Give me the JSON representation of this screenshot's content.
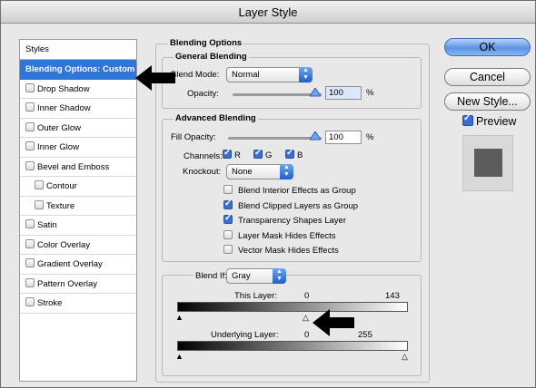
{
  "window": {
    "title": "Layer Style"
  },
  "sidebar": {
    "header": "Styles",
    "items": [
      {
        "label": "Blending Options: Custom",
        "selected": true,
        "checkbox": false,
        "checked": false,
        "indent": false
      },
      {
        "label": "Drop Shadow",
        "selected": false,
        "checkbox": true,
        "checked": false,
        "indent": false
      },
      {
        "label": "Inner Shadow",
        "selected": false,
        "checkbox": true,
        "checked": false,
        "indent": false
      },
      {
        "label": "Outer Glow",
        "selected": false,
        "checkbox": true,
        "checked": false,
        "indent": false
      },
      {
        "label": "Inner Glow",
        "selected": false,
        "checkbox": true,
        "checked": false,
        "indent": false
      },
      {
        "label": "Bevel and Emboss",
        "selected": false,
        "checkbox": true,
        "checked": false,
        "indent": false
      },
      {
        "label": "Contour",
        "selected": false,
        "checkbox": true,
        "checked": false,
        "indent": true
      },
      {
        "label": "Texture",
        "selected": false,
        "checkbox": true,
        "checked": false,
        "indent": true
      },
      {
        "label": "Satin",
        "selected": false,
        "checkbox": true,
        "checked": false,
        "indent": false
      },
      {
        "label": "Color Overlay",
        "selected": false,
        "checkbox": true,
        "checked": false,
        "indent": false
      },
      {
        "label": "Gradient Overlay",
        "selected": false,
        "checkbox": true,
        "checked": false,
        "indent": false
      },
      {
        "label": "Pattern Overlay",
        "selected": false,
        "checkbox": true,
        "checked": false,
        "indent": false
      },
      {
        "label": "Stroke",
        "selected": false,
        "checkbox": true,
        "checked": false,
        "indent": false
      }
    ]
  },
  "blending_options": {
    "title": "Blending Options",
    "general": {
      "title": "General Blending",
      "blend_mode_label": "Blend Mode:",
      "blend_mode_value": "Normal",
      "opacity_label": "Opacity:",
      "opacity_value": "100",
      "opacity_unit": "%",
      "opacity_fraction": 1.0
    },
    "advanced": {
      "title": "Advanced Blending",
      "fill_opacity_label": "Fill Opacity:",
      "fill_opacity_value": "100",
      "fill_opacity_unit": "%",
      "fill_opacity_fraction": 1.0,
      "channels_label": "Channels:",
      "channels": [
        {
          "label": "R",
          "checked": true
        },
        {
          "label": "G",
          "checked": true
        },
        {
          "label": "B",
          "checked": true
        }
      ],
      "knockout_label": "Knockout:",
      "knockout_value": "None",
      "options": [
        {
          "label": "Blend Interior Effects as Group",
          "checked": false
        },
        {
          "label": "Blend Clipped Layers as Group",
          "checked": true
        },
        {
          "label": "Transparency Shapes Layer",
          "checked": true
        },
        {
          "label": "Layer Mask Hides Effects",
          "checked": false
        },
        {
          "label": "Vector Mask Hides Effects",
          "checked": false
        }
      ]
    },
    "blend_if": {
      "label": "Blend If:",
      "value": "Gray",
      "this_layer_label": "This Layer:",
      "this_layer_low": "0",
      "this_layer_high": "143",
      "underlying_label": "Underlying Layer:",
      "underlying_low": "0",
      "underlying_high": "255"
    }
  },
  "buttons": {
    "ok": "OK",
    "cancel": "Cancel",
    "new_style": "New Style...",
    "preview_label": "Preview",
    "preview_checked": true
  },
  "colors": {
    "selection": "#2f76d6",
    "ok_button": "#5b93e6",
    "preview_swatch": "#5c5c5c"
  }
}
